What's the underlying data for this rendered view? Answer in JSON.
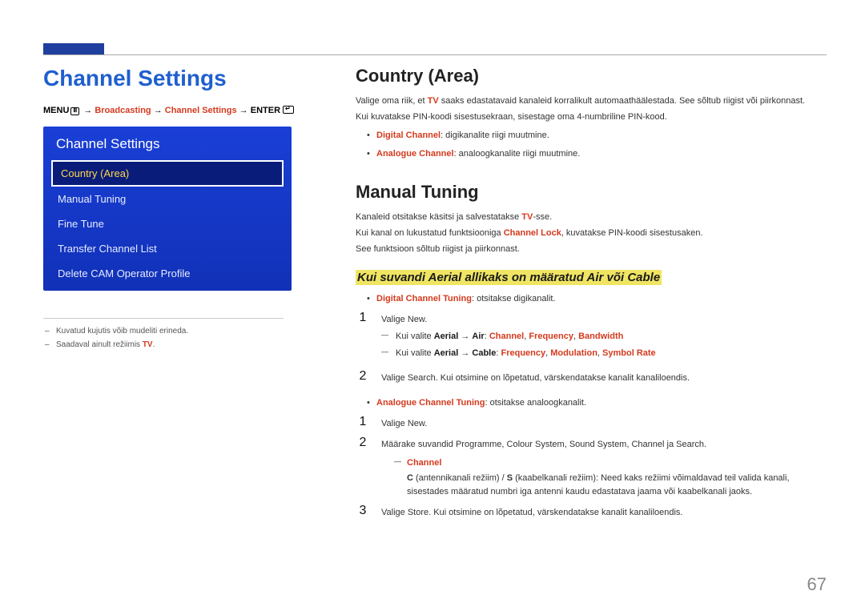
{
  "left": {
    "title": "Channel Settings",
    "breadcrumb": {
      "menu": "MENU",
      "arrow": " → ",
      "p1": "Broadcasting",
      "p2": "Channel Settings",
      "enter": "ENTER"
    },
    "panel": {
      "title": "Channel Settings",
      "items": [
        "Country (Area)",
        "Manual Tuning",
        "Fine Tune",
        "Transfer Channel List",
        "Delete CAM Operator Profile"
      ]
    },
    "footnotes": {
      "f1": "Kuvatud kujutis võib mudeliti erineda.",
      "f2_a": "Saadaval ainult režiimis ",
      "f2_b": "TV",
      "f2_c": "."
    }
  },
  "right": {
    "country": {
      "h": "Country (Area)",
      "p1_a": "Valige oma riik, et ",
      "p1_b": "TV",
      "p1_c": " saaks edastatavaid kanaleid korralikult automaathäälestada. See sõltub riigist või piirkonnast.",
      "p2": "Kui kuvatakse PIN-koodi sisestusekraan, sisestage oma 4-numbriline PIN-kood.",
      "b1_a": "Digital Channel",
      "b1_b": ": digikanalite riigi muutmine.",
      "b2_a": "Analogue Channel",
      "b2_b": ": analoogkanalite riigi muutmine."
    },
    "manual": {
      "h": "Manual Tuning",
      "p1_a": "Kanaleid otsitakse käsitsi ja salvestatakse ",
      "p1_b": "TV",
      "p1_c": "-sse.",
      "p2_a": "Kui kanal on lukustatud funktsiooniga ",
      "p2_b": "Channel Lock",
      "p2_c": ", kuvatakse PIN-koodi sisestusaken.",
      "p3": "See funktsioon sõltub riigist ja piirkonnast.",
      "h3": "Kui suvandi Aerial allikaks on määratud Air või Cable",
      "dct_a": "Digital Channel Tuning",
      "dct_b": ": otsitakse digikanalit.",
      "s1_a": "Valige ",
      "s1_b": "New",
      "s1_c": ".",
      "d1_a": "Kui valite ",
      "d1_b": "Aerial",
      "d1_c": " → ",
      "d1_d": "Air",
      "d1_e": ": ",
      "d1_f": "Channel",
      "d1_g": ", ",
      "d1_h": "Frequency",
      "d1_i": ", ",
      "d1_j": "Bandwidth",
      "d2_a": "Kui valite ",
      "d2_b": "Aerial",
      "d2_c": " → ",
      "d2_d": "Cable",
      "d2_e": ": ",
      "d2_f": "Frequency",
      "d2_g": ", ",
      "d2_h": "Modulation",
      "d2_i": ", ",
      "d2_j": "Symbol Rate",
      "s2_a": "Valige ",
      "s2_b": "Search",
      "s2_c": ". Kui otsimine on lõpetatud, värskendatakse kanalit kanaliloendis.",
      "act_a": "Analogue Channel Tuning",
      "act_b": ": otsitakse analoogkanalit.",
      "a1_a": "Valige ",
      "a1_b": "New",
      "a1_c": ".",
      "a2_a": "Määrake suvandid ",
      "a2_b": "Programme",
      "a2_c": ", ",
      "a2_d": "Colour System",
      "a2_e": ", ",
      "a2_f": "Sound System",
      "a2_g": ", ",
      "a2_h": "Channel",
      "a2_i": " ja ",
      "a2_j": "Search",
      "a2_k": ".",
      "ch_lbl": "Channel",
      "ch_body_a": "C",
      "ch_body_b": " (antennikanali režiim) / ",
      "ch_body_c": "S",
      "ch_body_d": " (kaabelkanali režiim): Need kaks režiimi võimaldavad teil valida kanali, sisestades määratud numbri iga antenni kaudu edastatava jaama või kaabelkanali jaoks.",
      "a3_a": "Valige ",
      "a3_b": "Store",
      "a3_c": ". Kui otsimine on lõpetatud, värskendatakse kanalit kanaliloendis."
    }
  },
  "page_number": "67"
}
